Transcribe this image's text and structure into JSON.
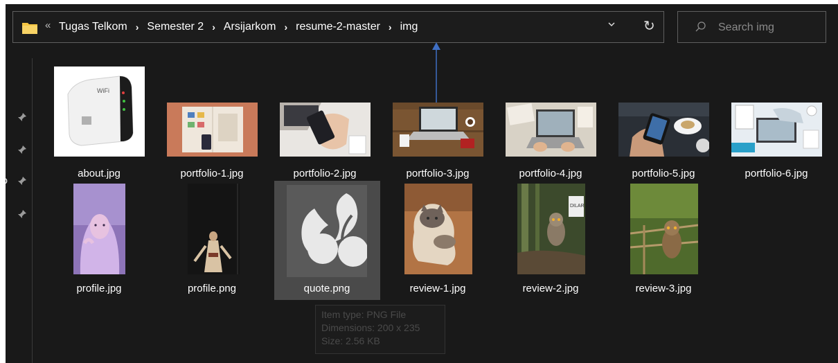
{
  "address_bar": {
    "overflow_glyph": "«",
    "breadcrumbs": [
      "Tugas Telkom",
      "Semester 2",
      "Arsijarkom",
      "resume-2-master",
      "img"
    ],
    "dropdown_glyph": "⌄",
    "refresh_glyph": "↻"
  },
  "search": {
    "placeholder": "Search img"
  },
  "nav_pane": {
    "partial_label": "io"
  },
  "files": [
    {
      "name": "about.jpg"
    },
    {
      "name": "portfolio-1.jpg"
    },
    {
      "name": "portfolio-2.jpg"
    },
    {
      "name": "portfolio-3.jpg"
    },
    {
      "name": "portfolio-4.jpg"
    },
    {
      "name": "portfolio-5.jpg"
    },
    {
      "name": "portfolio-6.jpg"
    },
    {
      "name": "profile.jpg"
    },
    {
      "name": "profile.png"
    },
    {
      "name": "quote.png"
    },
    {
      "name": "review-1.jpg"
    },
    {
      "name": "review-2.jpg"
    },
    {
      "name": "review-3.jpg"
    }
  ],
  "tooltip": {
    "type_line": "Item type: PNG File",
    "dimensions_line": "Dimensions: 200 x 235",
    "size_line": "Size: 2.56 KB"
  },
  "colors": {
    "background": "#191919",
    "selected": "#4a4a4a",
    "annotation_arrow": "#3f6fc4",
    "folder": "#f5c542"
  }
}
